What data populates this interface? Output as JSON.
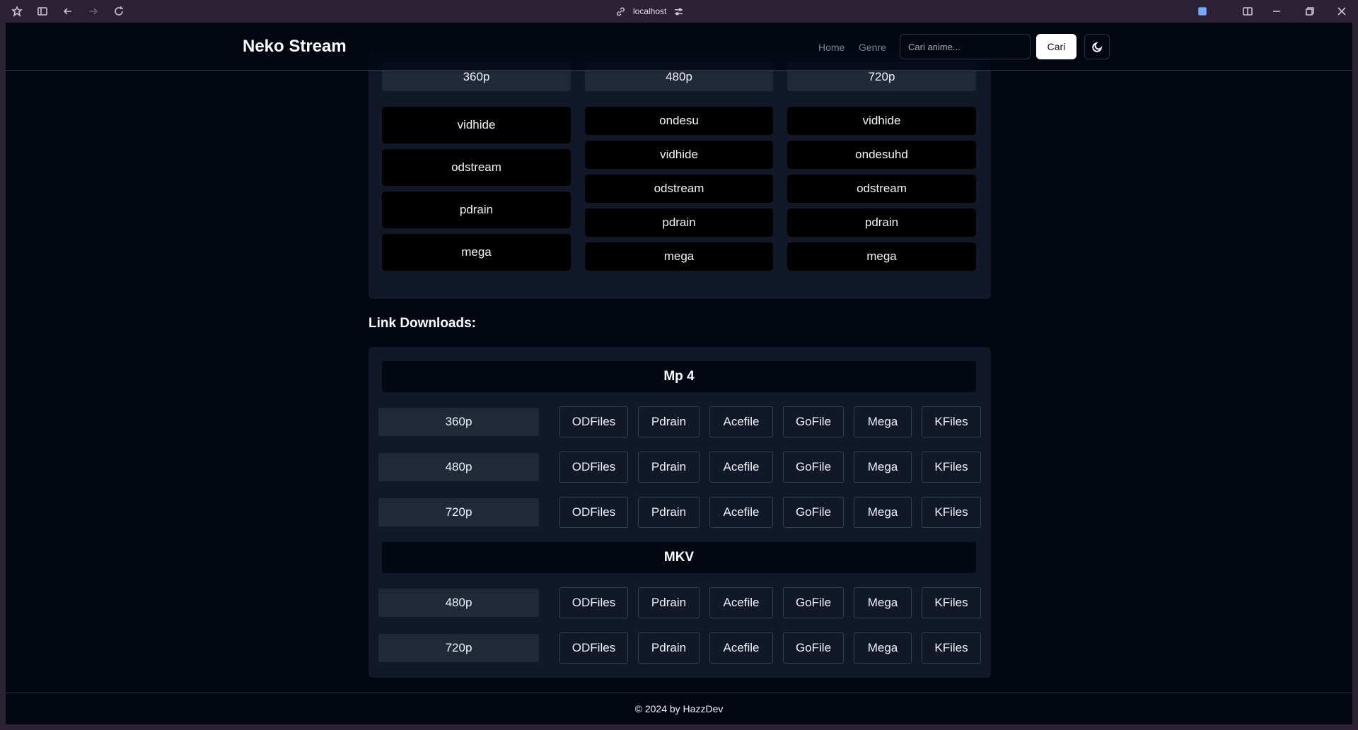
{
  "browser": {
    "url": "localhost"
  },
  "header": {
    "logo": "Neko Stream",
    "nav": [
      {
        "label": "Home"
      },
      {
        "label": "Genre"
      }
    ],
    "search_placeholder": "Cari anime...",
    "search_button": "Cari"
  },
  "streaming": {
    "columns": [
      {
        "resolution": "360p",
        "servers": [
          "vidhide",
          "odstream",
          "pdrain",
          "mega"
        ]
      },
      {
        "resolution": "480p",
        "servers": [
          "ondesu",
          "vidhide",
          "odstream",
          "pdrain",
          "mega"
        ]
      },
      {
        "resolution": "720p",
        "servers": [
          "vidhide",
          "ondesuhd",
          "odstream",
          "pdrain",
          "mega"
        ]
      }
    ]
  },
  "downloads": {
    "title": "Link Downloads:",
    "formats": [
      {
        "name": "Mp 4",
        "rows": [
          {
            "quality": "360p",
            "links": [
              "ODFiles",
              "Pdrain",
              "Acefile",
              "GoFile",
              "Mega",
              "KFiles"
            ]
          },
          {
            "quality": "480p",
            "links": [
              "ODFiles",
              "Pdrain",
              "Acefile",
              "GoFile",
              "Mega",
              "KFiles"
            ]
          },
          {
            "quality": "720p",
            "links": [
              "ODFiles",
              "Pdrain",
              "Acefile",
              "GoFile",
              "Mega",
              "KFiles"
            ]
          }
        ]
      },
      {
        "name": "MKV",
        "rows": [
          {
            "quality": "480p",
            "links": [
              "ODFiles",
              "Pdrain",
              "Acefile",
              "GoFile",
              "Mega",
              "KFiles"
            ]
          },
          {
            "quality": "720p",
            "links": [
              "ODFiles",
              "Pdrain",
              "Acefile",
              "GoFile",
              "Mega",
              "KFiles"
            ]
          }
        ]
      }
    ]
  },
  "footer": {
    "text": "© 2024 by HazzDev"
  }
}
